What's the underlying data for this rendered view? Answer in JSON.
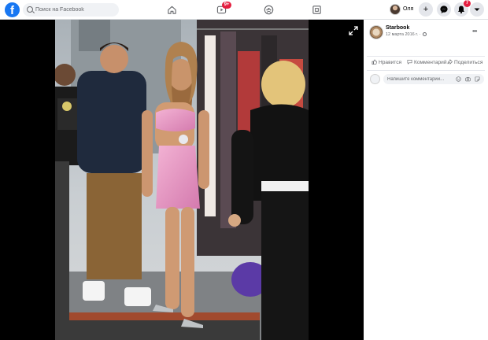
{
  "header": {
    "logo": "f",
    "search": {
      "placeholder": "Поиск на Facebook"
    },
    "nav": {
      "home_icon": "home-icon",
      "watch_icon": "watch-icon",
      "watch_badge": "9+",
      "groups_icon": "groups-icon",
      "gaming_icon": "gaming-icon"
    },
    "profile": {
      "name": "Оля"
    },
    "buttons": {
      "create": "+",
      "messenger_icon": "messenger-icon",
      "notifications_badge": "7",
      "menu_icon": "chevron-down-icon"
    },
    "colors": {
      "brand": "#1877f2",
      "badge": "#e41e3f"
    }
  },
  "viewer": {
    "image_description": "photo",
    "expand_icon": "expand-icon"
  },
  "post": {
    "page_name": "Starbook",
    "date": "12 марта 2016 г.",
    "privacy_icon": "globe-icon",
    "more_icon": "more-dots-icon",
    "actions": {
      "like": "Нравится",
      "comment": "Комментарий",
      "share": "Поделиться"
    },
    "comment": {
      "placeholder": "Напишите комментарий..."
    }
  }
}
